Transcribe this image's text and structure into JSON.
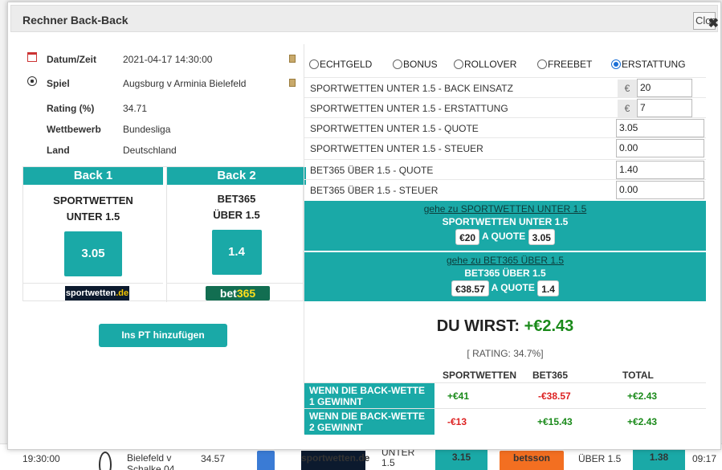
{
  "modal": {
    "title": "Rechner Back-Back",
    "close_label": "Close"
  },
  "info": {
    "date_label": "Datum/Zeit",
    "date_value": "2021-04-17 14:30:00",
    "match_label": "Spiel",
    "match_value": "Augsburg v Arminia Bielefeld",
    "rating_label": "Rating (%)",
    "rating_value": "34.71",
    "competition_label": "Wettbewerb",
    "competition_value": "Bundesliga",
    "country_label": "Land",
    "country_value": "Deutschland"
  },
  "back1": {
    "header": "Back 1",
    "name_line1": "SPORTWETTEN",
    "name_line2": "UNTER 1.5",
    "odds": "3.05",
    "logo_main": "sportwetten",
    "logo_suffix": ".de"
  },
  "back2": {
    "header": "Back 2",
    "name_line1": "BET365",
    "name_line2": "ÜBER 1.5",
    "odds": "1.4",
    "logo_main": "bet",
    "logo_suffix": "365"
  },
  "add_pt_label": "Ins PT hinzufügen",
  "radios": [
    {
      "label": "ECHTGELD",
      "checked": false
    },
    {
      "label": "BONUS",
      "checked": false
    },
    {
      "label": "ROLLOVER",
      "checked": false
    },
    {
      "label": "FREEBET",
      "checked": false
    },
    {
      "label": "ERSTATTUNG",
      "checked": true
    }
  ],
  "fields": {
    "stake_label": "SPORTWETTEN UNTER 1.5 - BACK EINSATZ",
    "stake_currency": "€",
    "stake_value": "20",
    "refund_label": "SPORTWETTEN UNTER 1.5 - ERSTATTUNG",
    "refund_currency": "€",
    "refund_value": "7",
    "q1_label": "SPORTWETTEN UNTER 1.5 - QUOTE",
    "q1_value": "3.05",
    "tax1_label": "SPORTWETTEN UNTER 1.5 - STEUER",
    "tax1_value": "0.00",
    "q2_label": "BET365 ÜBER 1.5  - QUOTE",
    "q2_value": "1.40",
    "tax2_label": "BET365 ÜBER 1.5 - STEUER",
    "tax2_value": "0.00"
  },
  "bet1": {
    "link": "gehe zu SPORTWETTEN UNTER 1.5",
    "title": "SPORTWETTEN UNTER 1.5",
    "stake": "€20",
    "at_quote": "A QUOTE",
    "quote": "3.05"
  },
  "bet2": {
    "link": "gehe zu BET365 ÜBER 1.5",
    "title": "BET365 ÜBER 1.5",
    "stake": "€38.57",
    "at_quote": "A QUOTE",
    "quote": "1.4"
  },
  "result": {
    "prefix": "DU WIRST:",
    "amount": "+€2.43",
    "rating": "[ RATING: 34.7%]"
  },
  "outcome": {
    "headers": [
      "SPORTWETTEN",
      "BET365",
      "TOTAL"
    ],
    "rows": [
      {
        "label": "WENN DIE BACK-WETTE 1 GEWINNT",
        "sw": "+€41",
        "b365": "-€38.57",
        "total": "+€2.43"
      },
      {
        "label": "WENN DIE BACK-WETTE 2 GEWINNT",
        "sw": "-€13",
        "b365": "+€15.43",
        "total": "+€2.43"
      }
    ]
  },
  "background_row": {
    "time": "19:30:00",
    "match": "Bielefeld v Schalke 04",
    "rating": "34.57",
    "bookie1": "sportwetten.de",
    "market1": "UNTER 1.5",
    "odds1": "3.15",
    "bookie2": "betsson",
    "market2": "ÜBER 1.5",
    "odds2": "1.38",
    "time2": "09:17"
  }
}
